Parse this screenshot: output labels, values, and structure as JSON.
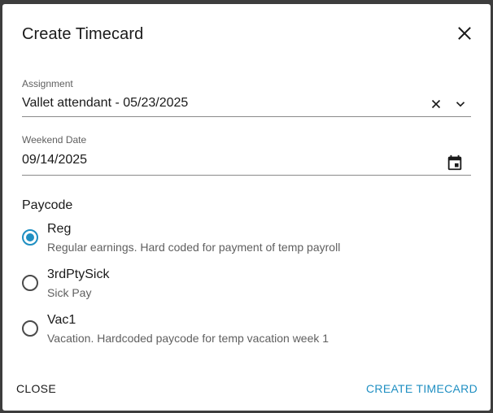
{
  "dialog": {
    "title": "Create Timecard"
  },
  "assignment": {
    "label": "Assignment",
    "value": "Vallet attendant - 05/23/2025"
  },
  "weekend_date": {
    "label": "Weekend Date",
    "value": "09/14/2025"
  },
  "paycode": {
    "title": "Paycode",
    "options": [
      {
        "name": "Reg",
        "description": "Regular earnings. Hard coded for payment of temp payroll",
        "selected": true
      },
      {
        "name": "3rdPtySick",
        "description": "Sick Pay",
        "selected": false
      },
      {
        "name": "Vac1",
        "description": "Vacation. Hardcoded paycode for temp vacation week 1",
        "selected": false
      }
    ]
  },
  "actions": {
    "close_label": "CLOSE",
    "create_label": "CREATE TIMECARD"
  },
  "colors": {
    "accent": "#1f8fc2",
    "backdrop": "#3d3d3d"
  }
}
